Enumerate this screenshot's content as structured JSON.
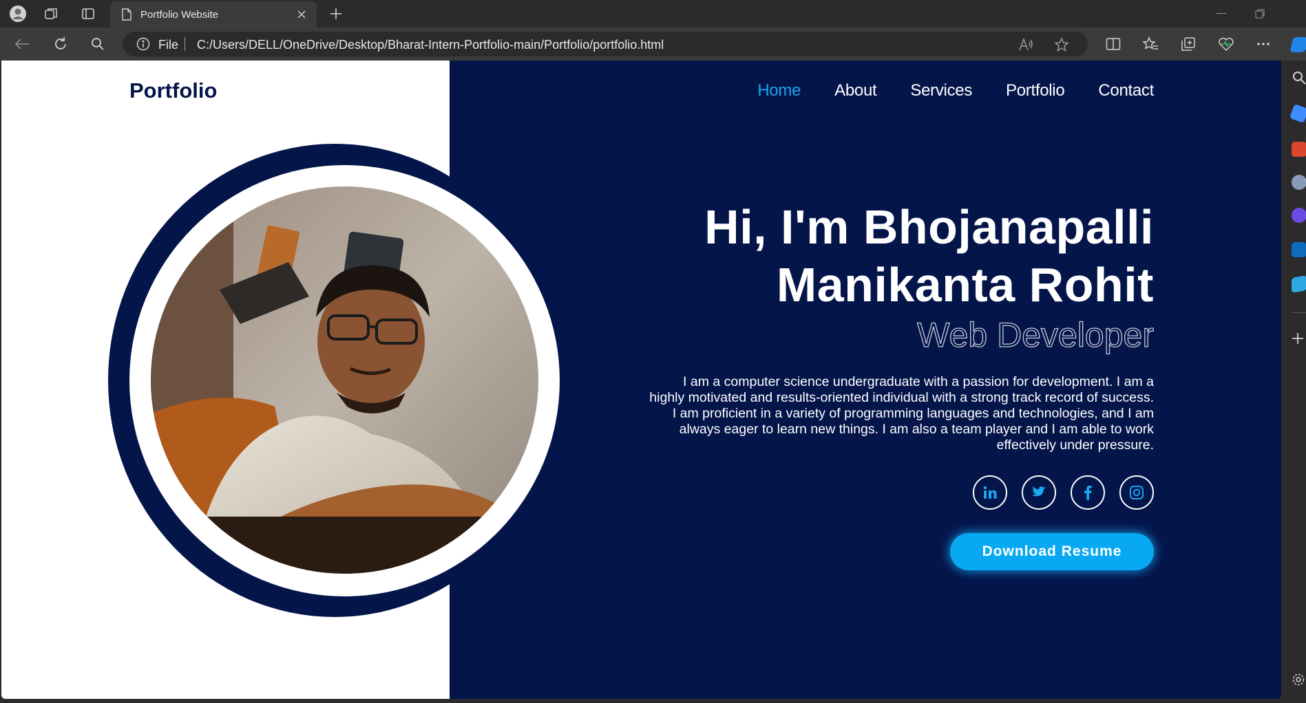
{
  "browser": {
    "tab_title": "Portfolio Website",
    "omnibox_scheme": "File",
    "url": "C:/Users/DELL/OneDrive/Desktop/Bharat-Intern-Portfolio-main/Portfolio/portfolio.html"
  },
  "page": {
    "logo": "Portfolio",
    "nav": [
      {
        "label": "Home",
        "active": true
      },
      {
        "label": "About",
        "active": false
      },
      {
        "label": "Services",
        "active": false
      },
      {
        "label": "Portfolio",
        "active": false
      },
      {
        "label": "Contact",
        "active": false
      }
    ],
    "hero": {
      "name_line1": "Hi, I'm Bhojanapalli",
      "name_line2": "Manikanta Rohit",
      "role": "Web Developer",
      "description": "I am a computer science undergraduate with a passion for development. I am a highly motivated and results-oriented individual with a strong track record of success. I am proficient in a variety of programming languages and technologies, and I am always eager to learn new things. I am also a team player and I am able to work effectively under pressure.",
      "socials": [
        "linkedin-icon",
        "twitter-icon",
        "facebook-icon",
        "instagram-icon"
      ],
      "resume_button": "Download Resume"
    },
    "colors": {
      "navy": "#04154a",
      "accent": "#1aa6f0",
      "button": "#08a9f2"
    }
  }
}
